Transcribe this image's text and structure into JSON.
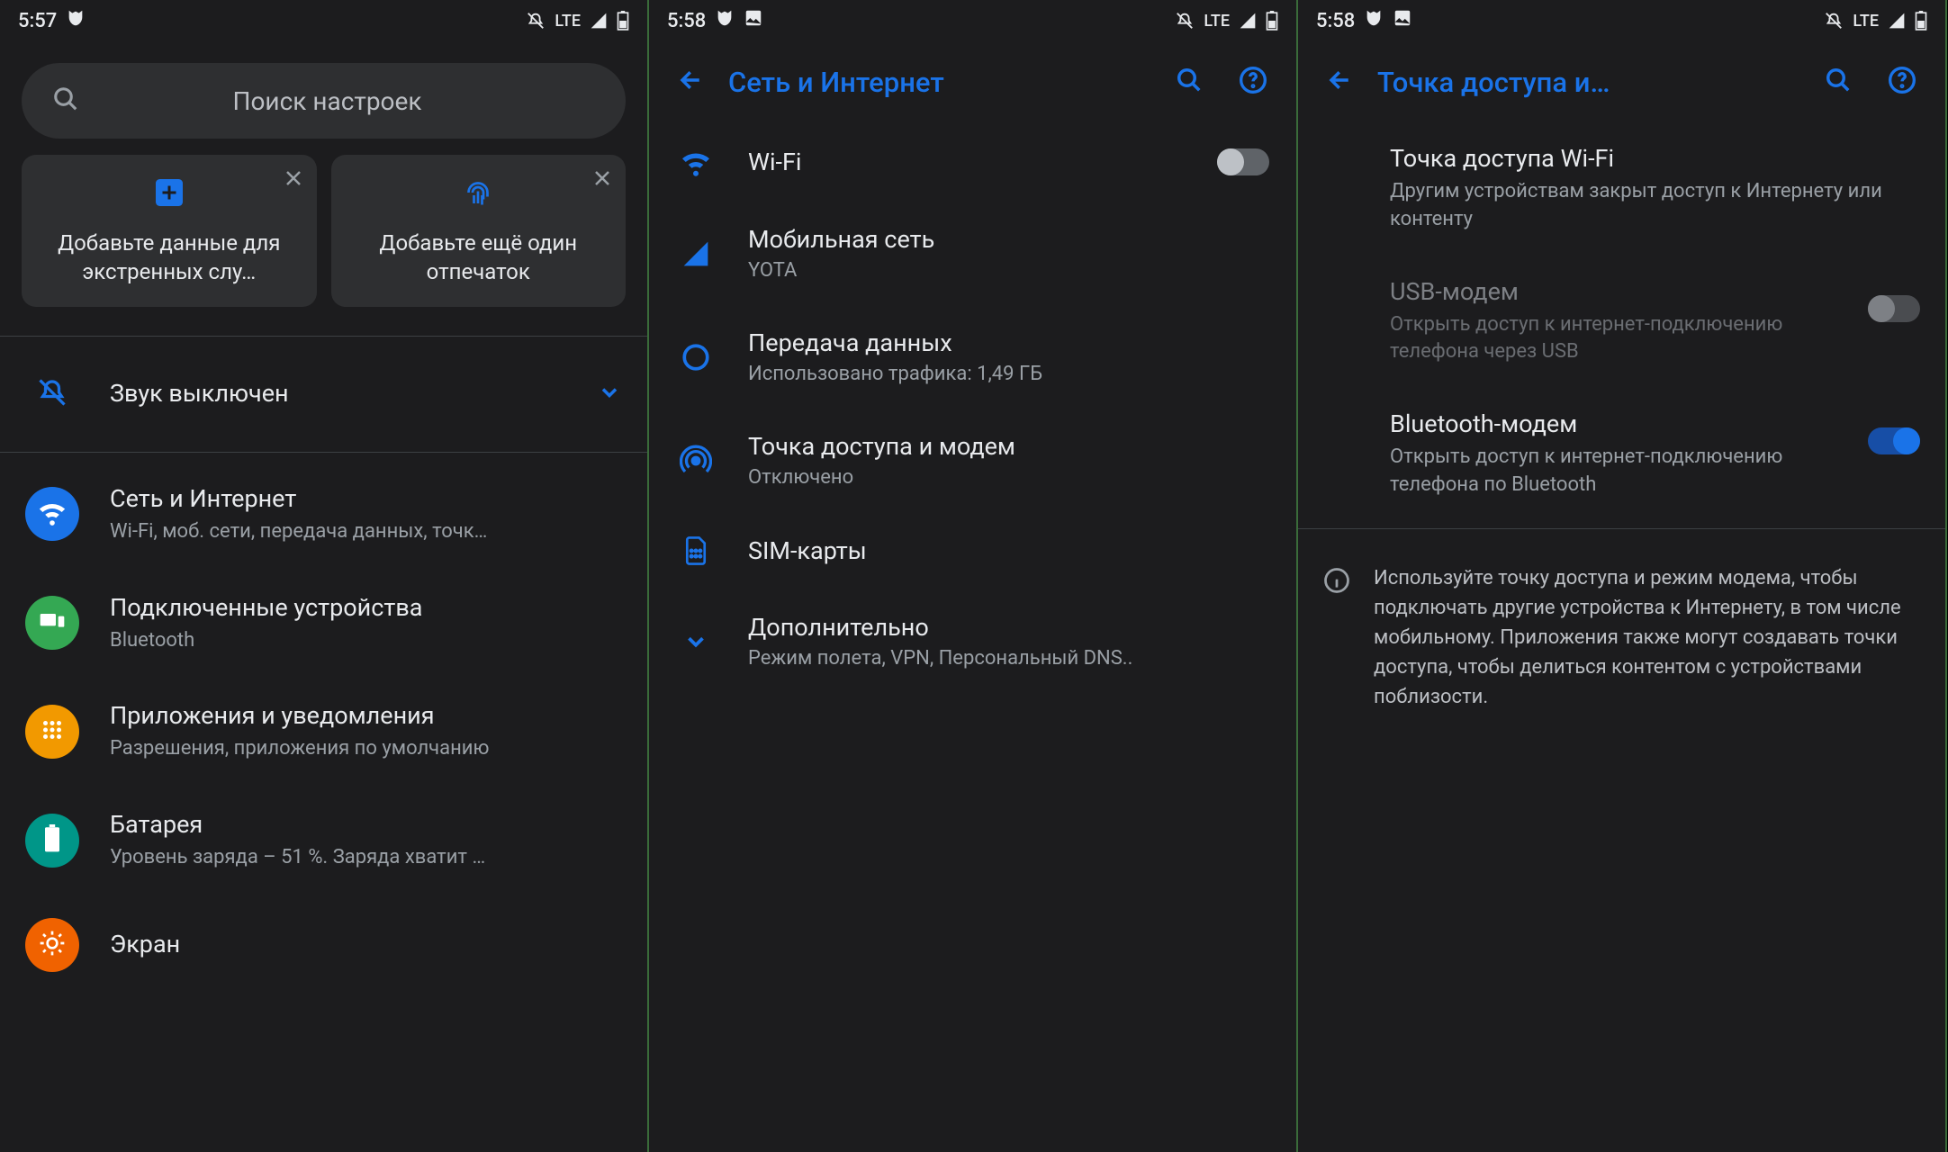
{
  "s1": {
    "time": "5:57",
    "network": "LTE",
    "search_placeholder": "Поиск настроек",
    "card1": "Добавьте данные для экстренных слу…",
    "card2": "Добавьте ещё один отпечаток",
    "sound_row": "Звук выключен",
    "items": [
      {
        "title": "Сеть и Интернет",
        "sub": "Wi-Fi, моб. сети, передача данных, точк…"
      },
      {
        "title": "Подключенные устройства",
        "sub": "Bluetooth"
      },
      {
        "title": "Приложения и уведомления",
        "sub": "Разрешения, приложения по умолчанию"
      },
      {
        "title": "Батарея",
        "sub": "Уровень заряда – 51 %. Заряда хватит …"
      },
      {
        "title": "Экран",
        "sub": ""
      }
    ]
  },
  "s2": {
    "time": "5:58",
    "network": "LTE",
    "title": "Сеть и Интернет",
    "items": [
      {
        "title": "Wi-Fi",
        "sub": ""
      },
      {
        "title": "Мобильная сеть",
        "sub": "YOTA"
      },
      {
        "title": "Передача данных",
        "sub": "Использовано трафика: 1,49 ГБ"
      },
      {
        "title": "Точка доступа и модем",
        "sub": "Отключено"
      },
      {
        "title": "SIM-карты",
        "sub": ""
      },
      {
        "title": "Дополнительно",
        "sub": "Режим полета, VPN, Персональный DNS.."
      }
    ]
  },
  "s3": {
    "time": "5:58",
    "network": "LTE",
    "title": "Точка доступа и…",
    "wifi_ap_title": "Точка доступа Wi-Fi",
    "wifi_ap_sub": "Другим устройствам закрыт доступ к Интернету или контенту",
    "usb_title": "USB-модем",
    "usb_sub": "Открыть доступ к интернет-подключению телефона через USB",
    "bt_title": "Bluetooth-модем",
    "bt_sub": "Открыть доступ к интернет-подключению телефона по Bluetooth",
    "info": "Используйте точку доступа и режим модема, чтобы подключать другие устройства к Интернету, в том числе мобильному. Приложения также могут создавать точки доступа, чтобы делиться контентом с устройствами поблизости."
  }
}
